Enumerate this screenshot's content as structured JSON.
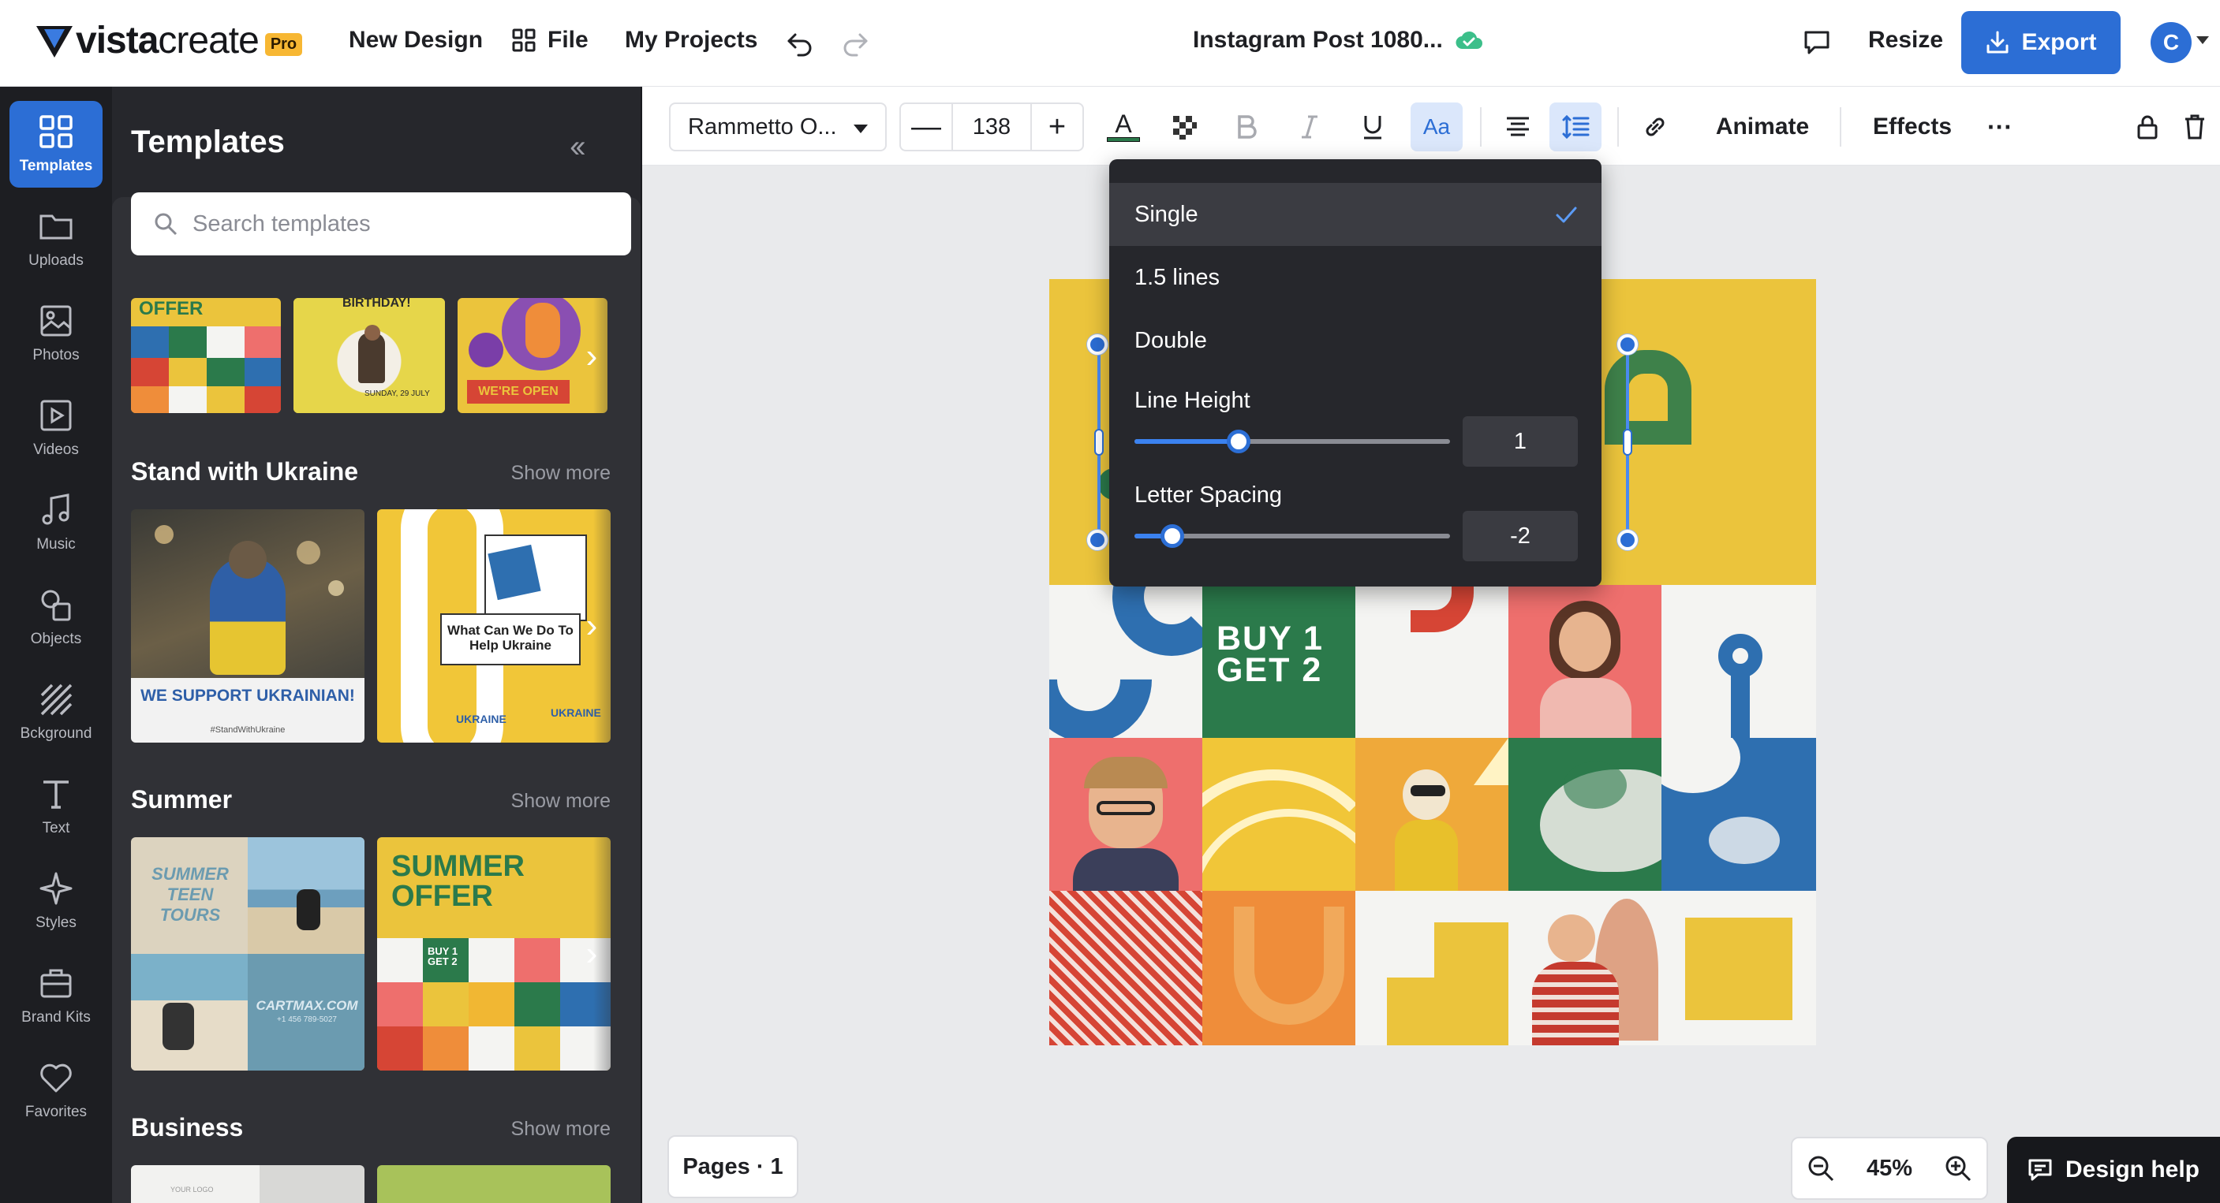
{
  "header": {
    "logo_text_bold": "vista",
    "logo_text_light": "create",
    "pro_badge": "Pro",
    "new_design": "New Design",
    "file": "File",
    "my_projects": "My Projects",
    "doc_title": "Instagram Post 1080...",
    "resize": "Resize",
    "export": "Export",
    "avatar_initial": "C",
    "accent_color": "#2c6ed5"
  },
  "rail": {
    "items": [
      {
        "label": "Templates",
        "icon": "templates-icon"
      },
      {
        "label": "Uploads",
        "icon": "folder-icon"
      },
      {
        "label": "Photos",
        "icon": "image-icon"
      },
      {
        "label": "Videos",
        "icon": "play-icon"
      },
      {
        "label": "Music",
        "icon": "music-icon"
      },
      {
        "label": "Objects",
        "icon": "shapes-icon"
      },
      {
        "label": "Bckground",
        "icon": "background-icon"
      },
      {
        "label": "Text",
        "icon": "text-icon"
      },
      {
        "label": "Styles",
        "icon": "sparkle-icon"
      },
      {
        "label": "Brand Kits",
        "icon": "briefcase-icon"
      },
      {
        "label": "Favorites",
        "icon": "heart-icon"
      }
    ]
  },
  "panel": {
    "title": "Templates",
    "search_placeholder": "Search templates",
    "row1": {
      "t1_text": "OFFER",
      "t2_text": "BIRTHDAY!",
      "t2_date": "SUNDAY, 29 JULY",
      "t3_text": "WE'RE OPEN"
    },
    "sections": [
      {
        "title": "Stand with Ukraine",
        "show_more": "Show more",
        "t1_caption": "WE SUPPORT UKRAINIAN!",
        "t1_sub": "#StandWithUkraine",
        "t2_caption": "What Can We Do To Help Ukraine",
        "t2_ring": "UKRAINE"
      },
      {
        "title": "Summer",
        "show_more": "Show more",
        "t1_caption": "SUMMER TEEN TOURS",
        "t1_site": "CARTMAX.COM",
        "t1_phone": "+1 456 789-5027",
        "t2_caption": "SUMMER OFFER",
        "t2_badge": "BUY 1 GET 2"
      },
      {
        "title": "Business",
        "show_more": "Show more",
        "t1_caption": "YOUR LOGO"
      }
    ]
  },
  "toolbar": {
    "font": "Rammetto O...",
    "size": "138",
    "minus": "—",
    "plus": "+",
    "text_color_label": "A",
    "case_label": "Aa",
    "animate": "Animate",
    "effects": "Effects",
    "more": "···"
  },
  "spacing_dropdown": {
    "options": [
      "Single",
      "1.5 lines",
      "Double"
    ],
    "selected": "Single",
    "line_height_label": "Line Height",
    "line_height_value": "1",
    "line_height_fraction": 0.33,
    "letter_spacing_label": "Letter Spacing",
    "letter_spacing_value": "-2",
    "letter_spacing_fraction": 0.12
  },
  "canvas": {
    "badge_line1": "BUY 1",
    "badge_line2": "GET 2",
    "colors": {
      "yellow": "#ebc43c",
      "green": "#2b7a4b",
      "blue": "#2e6fb0",
      "red": "#d64535",
      "pink": "#ee6f6d",
      "orange": "#ef8d3a"
    }
  },
  "footer": {
    "pages": "Pages · 1",
    "zoom": "45%",
    "design_help": "Design help"
  }
}
